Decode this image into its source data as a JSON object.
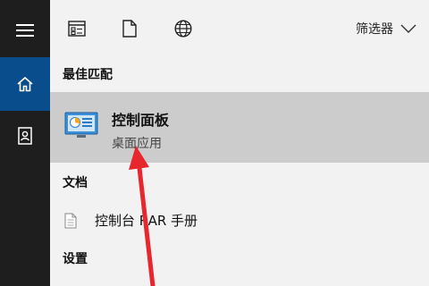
{
  "sidebar": {
    "menu_icon": "hamburger-menu-icon",
    "home_icon": "home-icon",
    "doc_icon": "document-profile-icon",
    "accent": "#0a4d8c"
  },
  "toolbar": {
    "icons": [
      "apps-list-icon",
      "document-icon",
      "globe-icon"
    ],
    "filter_label": "筛选器"
  },
  "results": {
    "best_match_header": "最佳匹配",
    "best_match": {
      "title": "控制面板",
      "subtitle": "桌面应用",
      "icon": "control-panel-icon"
    },
    "documents_header": "文档",
    "documents": [
      {
        "label": "控制台 RAR 手册",
        "icon": "file-icon"
      }
    ],
    "settings_header": "设置"
  },
  "annotation": {
    "arrow_color": "#e8262d"
  }
}
